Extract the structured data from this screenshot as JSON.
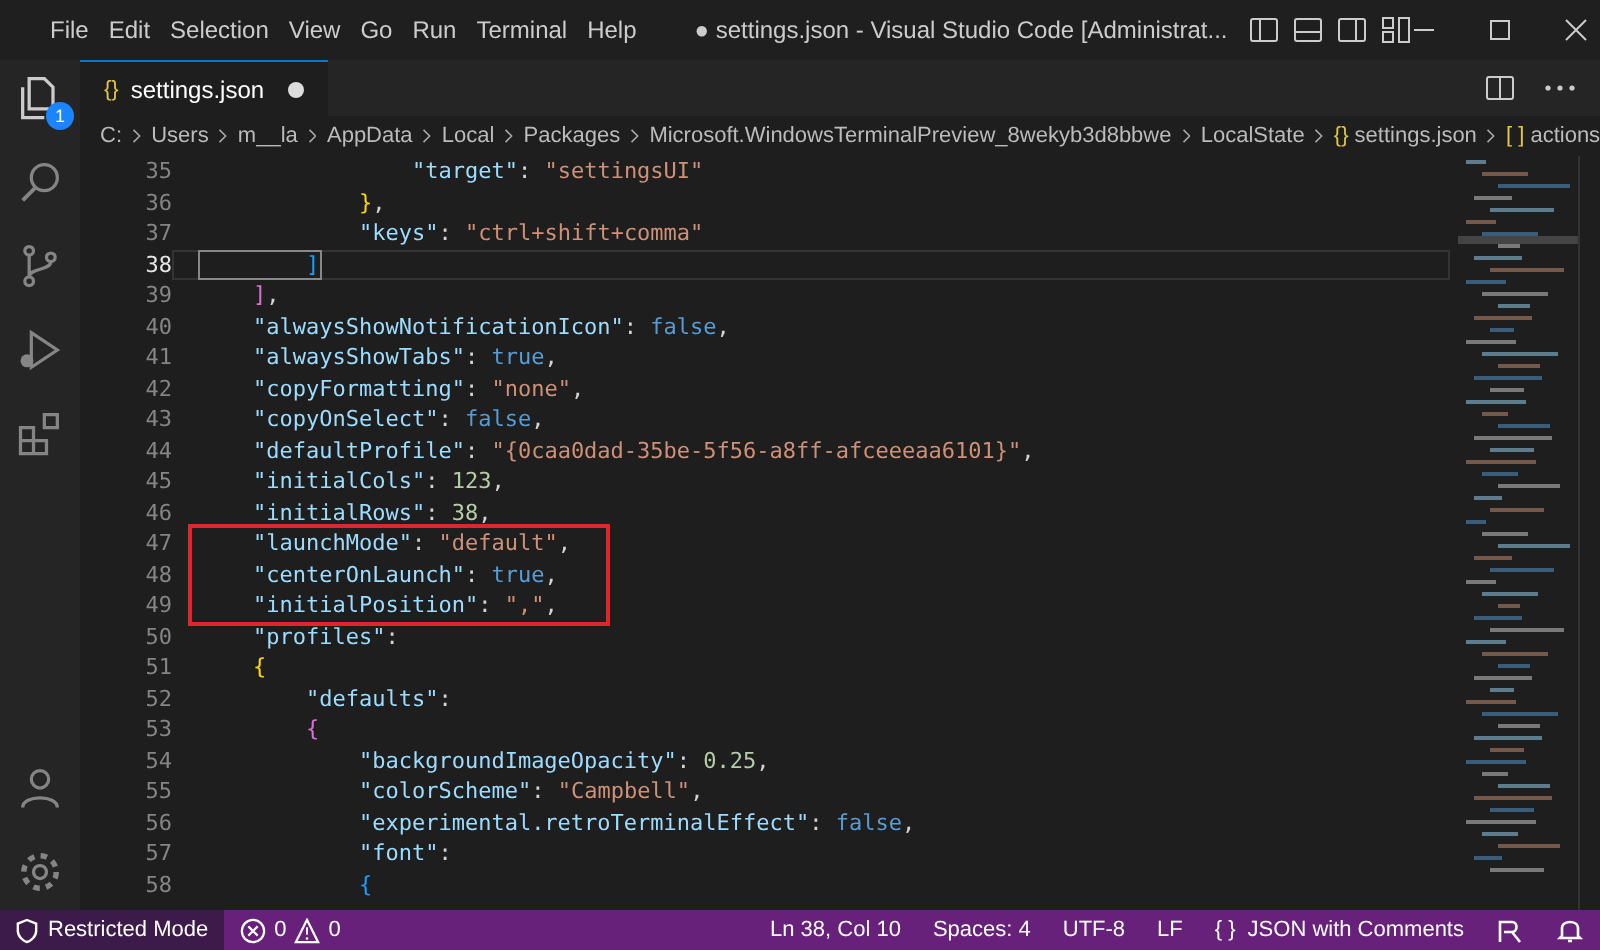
{
  "title_bar": {
    "menu": [
      "File",
      "Edit",
      "Selection",
      "View",
      "Go",
      "Run",
      "Terminal",
      "Help"
    ],
    "title": "● settings.json - Visual Studio Code [Administrat..."
  },
  "activity_bar": {
    "explorer_badge": "1"
  },
  "tab": {
    "icon": "{}",
    "label": "settings.json",
    "modified": true
  },
  "breadcrumb": [
    {
      "label": "C:"
    },
    {
      "label": "Users"
    },
    {
      "label": "m__la"
    },
    {
      "label": "AppData"
    },
    {
      "label": "Local"
    },
    {
      "label": "Packages"
    },
    {
      "label": "Microsoft.WindowsTerminalPreview_8wekyb3d8bbwe"
    },
    {
      "label": "LocalState"
    },
    {
      "icon": "{}",
      "label": "settings.json"
    },
    {
      "icon": "[ ]",
      "label": "actions"
    }
  ],
  "editor": {
    "lines": [
      {
        "number": "35",
        "current": false,
        "boxed": false,
        "tokens": [
          {
            "kind": "key",
            "text": "                \"target\""
          },
          {
            "kind": "punct",
            "text": ": "
          },
          {
            "kind": "string",
            "text": "\"settingsUI\""
          }
        ]
      },
      {
        "number": "36",
        "current": false,
        "boxed": false,
        "tokens": [
          {
            "kind": "bracket1",
            "text": "            }"
          },
          {
            "kind": "punct",
            "text": ","
          }
        ]
      },
      {
        "number": "37",
        "current": false,
        "boxed": false,
        "tokens": [
          {
            "kind": "key",
            "text": "            \"keys\""
          },
          {
            "kind": "punct",
            "text": ": "
          },
          {
            "kind": "string",
            "text": "\"ctrl+shift+comma\""
          }
        ]
      },
      {
        "number": "38",
        "current": true,
        "boxed": false,
        "tokens": [
          {
            "kind": "match",
            "text": "        ]"
          }
        ]
      },
      {
        "number": "39",
        "current": false,
        "boxed": false,
        "tokens": [
          {
            "kind": "bracket2",
            "text": "    ]"
          },
          {
            "kind": "punct",
            "text": ","
          }
        ]
      },
      {
        "number": "40",
        "current": false,
        "boxed": false,
        "tokens": [
          {
            "kind": "key",
            "text": "    \"alwaysShowNotificationIcon\""
          },
          {
            "kind": "punct",
            "text": ": "
          },
          {
            "kind": "keyword",
            "text": "false"
          },
          {
            "kind": "punct",
            "text": ","
          }
        ]
      },
      {
        "number": "41",
        "current": false,
        "boxed": false,
        "tokens": [
          {
            "kind": "key",
            "text": "    \"alwaysShowTabs\""
          },
          {
            "kind": "punct",
            "text": ": "
          },
          {
            "kind": "keyword",
            "text": "true"
          },
          {
            "kind": "punct",
            "text": ","
          }
        ]
      },
      {
        "number": "42",
        "current": false,
        "boxed": false,
        "tokens": [
          {
            "kind": "key",
            "text": "    \"copyFormatting\""
          },
          {
            "kind": "punct",
            "text": ": "
          },
          {
            "kind": "string",
            "text": "\"none\""
          },
          {
            "kind": "punct",
            "text": ","
          }
        ]
      },
      {
        "number": "43",
        "current": false,
        "boxed": false,
        "tokens": [
          {
            "kind": "key",
            "text": "    \"copyOnSelect\""
          },
          {
            "kind": "punct",
            "text": ": "
          },
          {
            "kind": "keyword",
            "text": "false"
          },
          {
            "kind": "punct",
            "text": ","
          }
        ]
      },
      {
        "number": "44",
        "current": false,
        "boxed": false,
        "tokens": [
          {
            "kind": "key",
            "text": "    \"defaultProfile\""
          },
          {
            "kind": "punct",
            "text": ": "
          },
          {
            "kind": "string",
            "text": "\"{0caa0dad-35be-5f56-a8ff-afceeeaa6101}\""
          },
          {
            "kind": "punct",
            "text": ","
          }
        ]
      },
      {
        "number": "45",
        "current": false,
        "boxed": false,
        "tokens": [
          {
            "kind": "key",
            "text": "    \"initialCols\""
          },
          {
            "kind": "punct",
            "text": ": "
          },
          {
            "kind": "number",
            "text": "123"
          },
          {
            "kind": "punct",
            "text": ","
          }
        ]
      },
      {
        "number": "46",
        "current": false,
        "boxed": false,
        "tokens": [
          {
            "kind": "key",
            "text": "    \"initialRows\""
          },
          {
            "kind": "punct",
            "text": ": "
          },
          {
            "kind": "number",
            "text": "38"
          },
          {
            "kind": "punct",
            "text": ","
          }
        ]
      },
      {
        "number": "47",
        "current": false,
        "boxed": true,
        "tokens": [
          {
            "kind": "key",
            "text": "    \"launchMode\""
          },
          {
            "kind": "punct",
            "text": ": "
          },
          {
            "kind": "string",
            "text": "\"default\""
          },
          {
            "kind": "punct",
            "text": ","
          }
        ]
      },
      {
        "number": "48",
        "current": false,
        "boxed": true,
        "tokens": [
          {
            "kind": "key",
            "text": "    \"centerOnLaunch\""
          },
          {
            "kind": "punct",
            "text": ": "
          },
          {
            "kind": "keyword",
            "text": "true"
          },
          {
            "kind": "punct",
            "text": ","
          }
        ]
      },
      {
        "number": "49",
        "current": false,
        "boxed": true,
        "tokens": [
          {
            "kind": "key",
            "text": "    \"initialPosition\""
          },
          {
            "kind": "punct",
            "text": ": "
          },
          {
            "kind": "string",
            "text": "\",\""
          },
          {
            "kind": "punct",
            "text": ","
          }
        ]
      },
      {
        "number": "50",
        "current": false,
        "boxed": false,
        "tokens": [
          {
            "kind": "key",
            "text": "    \"profiles\""
          },
          {
            "kind": "punct",
            "text": ":"
          }
        ]
      },
      {
        "number": "51",
        "current": false,
        "boxed": false,
        "tokens": [
          {
            "kind": "bracket1",
            "text": "    {"
          }
        ]
      },
      {
        "number": "52",
        "current": false,
        "boxed": false,
        "tokens": [
          {
            "kind": "key",
            "text": "        \"defaults\""
          },
          {
            "kind": "punct",
            "text": ":"
          }
        ]
      },
      {
        "number": "53",
        "current": false,
        "boxed": false,
        "tokens": [
          {
            "kind": "bracket2",
            "text": "        {"
          }
        ]
      },
      {
        "number": "54",
        "current": false,
        "boxed": false,
        "tokens": [
          {
            "kind": "key",
            "text": "            \"backgroundImageOpacity\""
          },
          {
            "kind": "punct",
            "text": ": "
          },
          {
            "kind": "number",
            "text": "0.25"
          },
          {
            "kind": "punct",
            "text": ","
          }
        ]
      },
      {
        "number": "55",
        "current": false,
        "boxed": false,
        "tokens": [
          {
            "kind": "key",
            "text": "            \"colorScheme\""
          },
          {
            "kind": "punct",
            "text": ": "
          },
          {
            "kind": "string",
            "text": "\"Campbell\""
          },
          {
            "kind": "punct",
            "text": ","
          }
        ]
      },
      {
        "number": "56",
        "current": false,
        "boxed": false,
        "tokens": [
          {
            "kind": "key",
            "text": "            \"experimental.retroTerminalEffect\""
          },
          {
            "kind": "punct",
            "text": ": "
          },
          {
            "kind": "keyword",
            "text": "false"
          },
          {
            "kind": "punct",
            "text": ","
          }
        ]
      },
      {
        "number": "57",
        "current": false,
        "boxed": false,
        "tokens": [
          {
            "kind": "key",
            "text": "            \"font\""
          },
          {
            "kind": "punct",
            "text": ":"
          }
        ]
      },
      {
        "number": "58",
        "current": false,
        "boxed": false,
        "tokens": [
          {
            "kind": "bracket3",
            "text": "            {"
          }
        ]
      }
    ]
  },
  "status_bar": {
    "mode": "Restricted Mode",
    "errors": "0",
    "warnings": "0",
    "position": "Ln 38, Col 10",
    "spaces": "Spaces: 4",
    "encoding": "UTF-8",
    "eol": "LF",
    "language_icon": "{ }",
    "language": "JSON with Comments"
  }
}
